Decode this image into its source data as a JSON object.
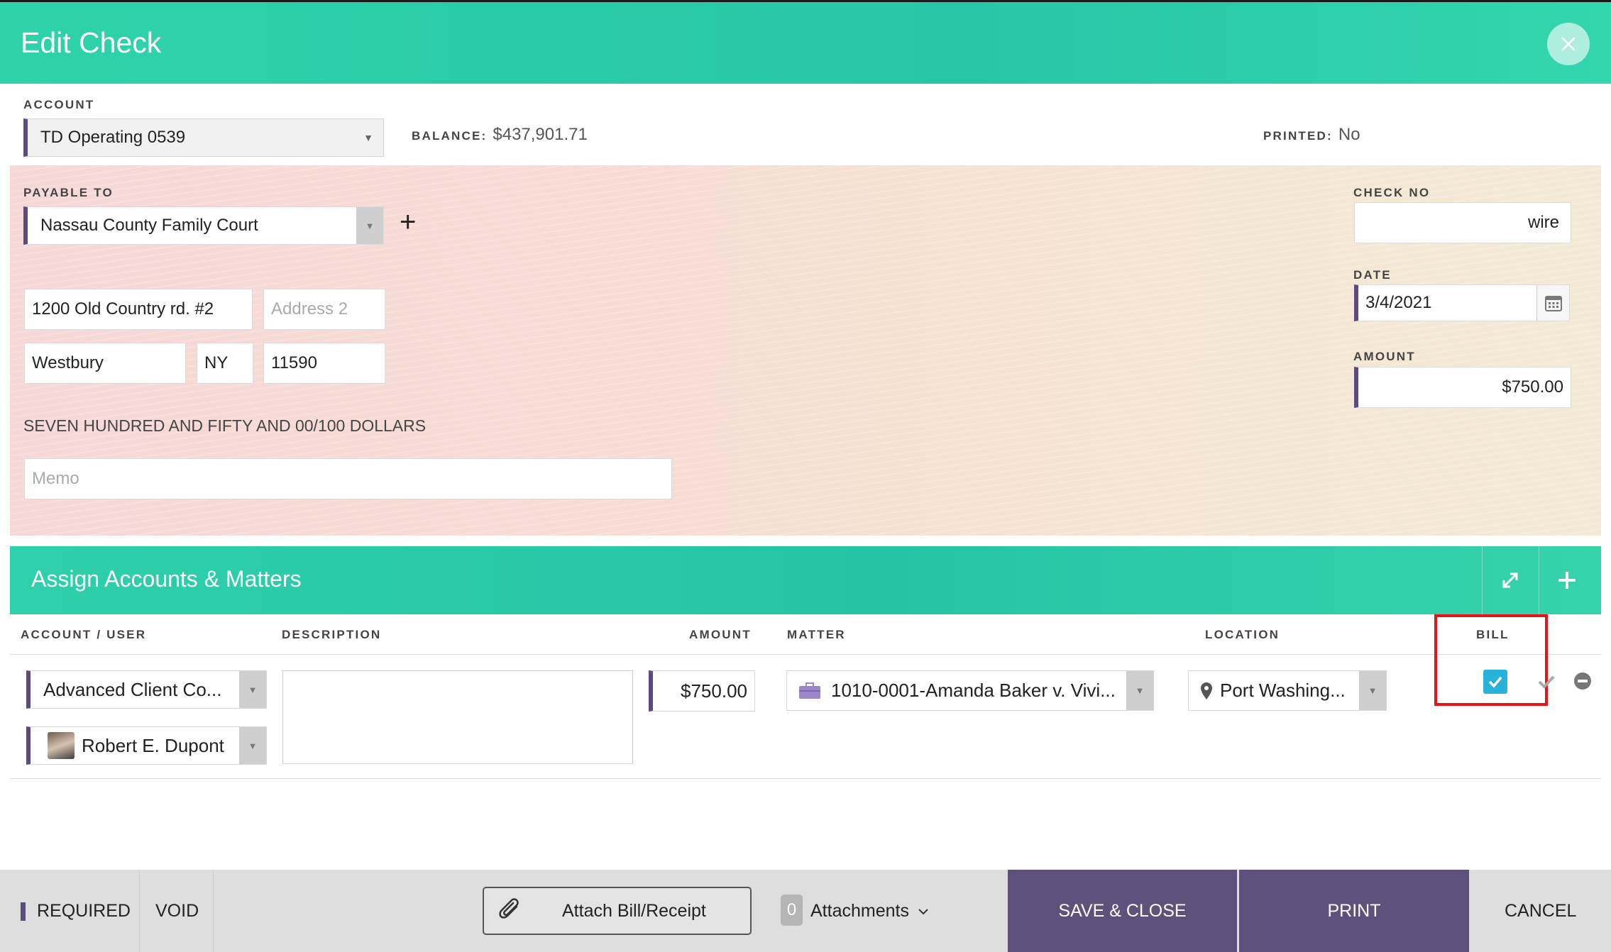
{
  "header": {
    "title": "Edit Check"
  },
  "account": {
    "label": "ACCOUNT",
    "selected": "TD Operating 0539",
    "balance_label": "BALANCE:",
    "balance_value": "$437,901.71",
    "printed_label": "PRINTED:",
    "printed_value": "No"
  },
  "check": {
    "payable_label": "PAYABLE TO",
    "payee": "Nassau County Family Court",
    "address1": "1200 Old Country rd. #2",
    "address2_placeholder": "Address 2",
    "city": "Westbury",
    "state": "NY",
    "zip": "11590",
    "amount_words": "SEVEN HUNDRED AND FIFTY AND 00/100 DOLLARS",
    "memo_placeholder": "Memo",
    "check_no_label": "CHECK NO",
    "check_no": "wire",
    "date_label": "DATE",
    "date": "3/4/2021",
    "amount_label": "AMOUNT",
    "amount": "$750.00"
  },
  "assign": {
    "title": "Assign Accounts & Matters",
    "columns": {
      "account_user": "ACCOUNT / USER",
      "description": "DESCRIPTION",
      "amount": "AMOUNT",
      "matter": "MATTER",
      "location": "LOCATION",
      "bill": "BILL"
    },
    "row": {
      "account": "Advanced Client Co...",
      "user": "Robert E. Dupont",
      "amount": "$750.00",
      "matter": "1010-0001-Amanda Baker v. Vivi...",
      "location": "Port Washing...",
      "bill_checked": true
    }
  },
  "footer": {
    "required": "REQUIRED",
    "void": "VOID",
    "attach": "Attach Bill/Receipt",
    "attachments_count": "0",
    "attachments_label": "Attachments",
    "save_close": "SAVE & CLOSE",
    "print": "PRINT",
    "cancel": "CANCEL"
  },
  "colors": {
    "accent_teal": "#27c6a8",
    "accent_purple": "#5e527c",
    "highlight_red": "#e3151a",
    "checkbox_blue": "#27b3d9"
  },
  "icons": [
    "close-icon",
    "plus-icon",
    "calendar-icon",
    "expand-icon",
    "briefcase-icon",
    "location-pin-icon",
    "check-icon",
    "remove-icon",
    "paperclip-icon",
    "chevron-down-icon"
  ]
}
